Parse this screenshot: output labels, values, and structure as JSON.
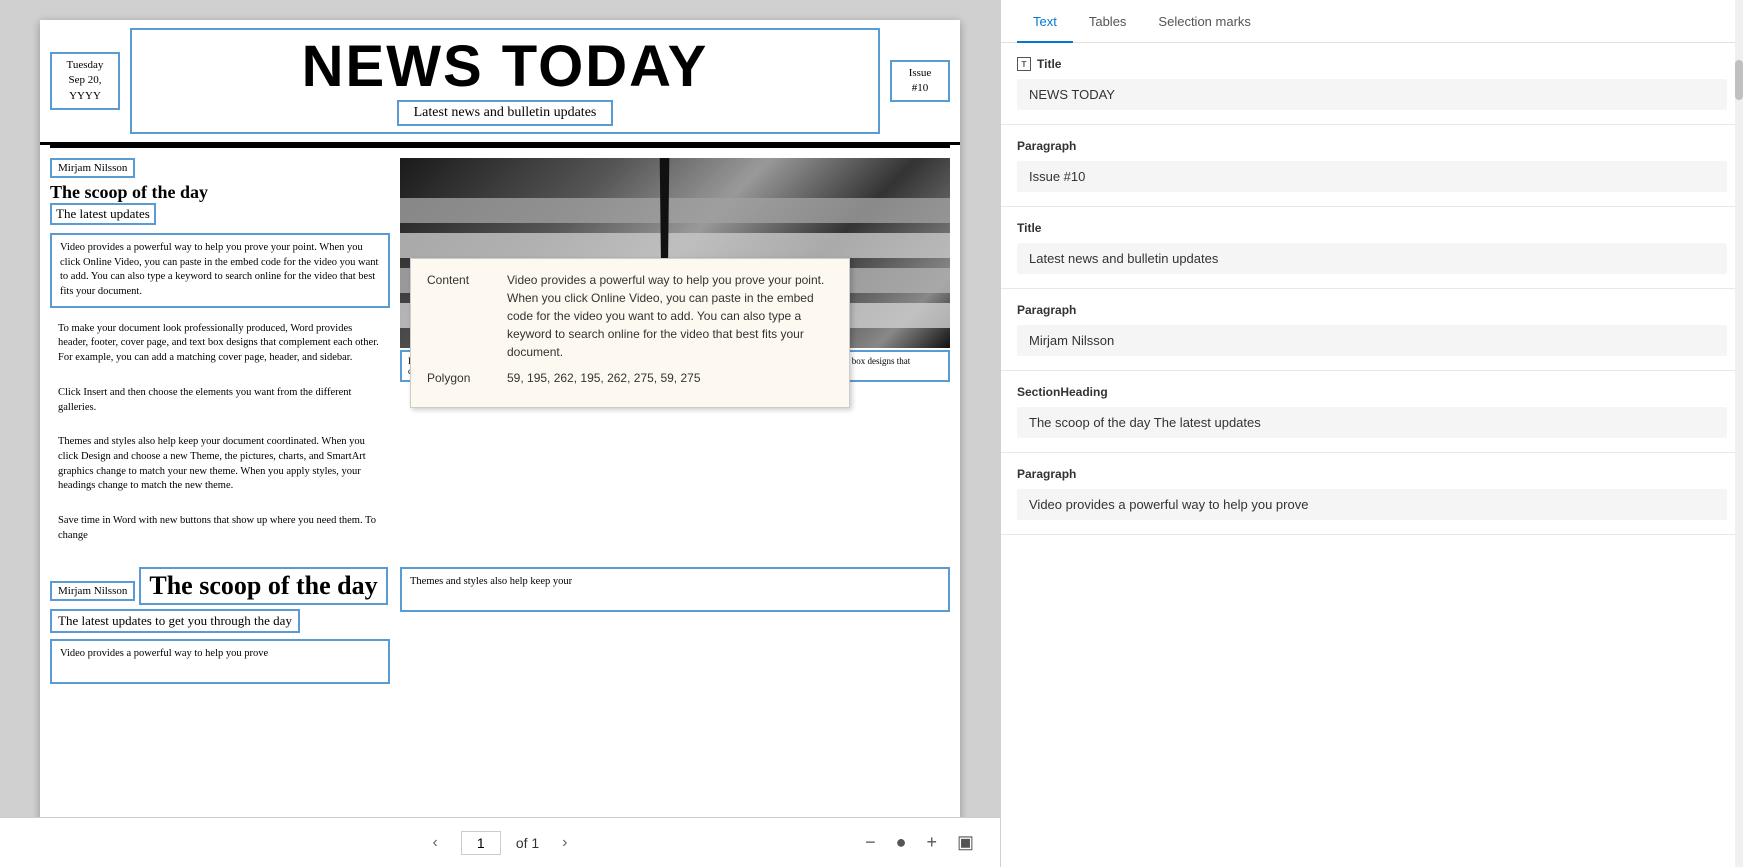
{
  "document": {
    "date": "Tuesday\nSep 20,\nYYYY",
    "title": "NEWS TODAY",
    "subtitle": "Latest news and bulletin updates",
    "issue": "Issue\n#10"
  },
  "left_column": {
    "author1": "Mirjam Nilsson",
    "heading1": "The scoop of the day",
    "subheading1": "The latest updates",
    "text1": "Video provides a powerful way to help you prove your point. When you click Online Video, you can paste in the embed code for the video you want to add. You can also type a keyword to search online for the video that best fits your document.",
    "text2": "To make your document look professionally produced, Word provides header, footer, cover page, and text box designs that complement each other. For example, you can add a matching cover page, header, and sidebar.",
    "text3": "Click Insert and then choose the elements you want from the different galleries.",
    "text4": "Themes and styles also help keep your document coordinated. When you click Design and choose a new Theme, the pictures, charts, and SmartArt graphics change to match your new theme. When you apply styles, your headings change to match the new theme.",
    "text5": "Save time in Word with new buttons that show up where you need them. To change"
  },
  "right_column": {
    "caption": "Picture Caption: To make your document look professionally produced, Word provides header, footer, cover page, and text box designs that complement each other.",
    "tooltip": {
      "content_label": "Content",
      "content_value": "Video provides a powerful way to help you prove your point. When you click Online Video, you can paste in the embed code for the video you want to add. You can also type a keyword to search online for the video that best fits your document.",
      "polygon_label": "Polygon",
      "polygon_value": "59, 195, 262, 195, 262, 275, 59, 275"
    }
  },
  "bottom_section": {
    "author2": "Mirjam Nilsson",
    "heading2": "The scoop of the day",
    "subheading2": "The latest updates to get you through the day",
    "text_partial": "Video provides a powerful way to help you prove",
    "themes_text": "Themes and styles also help keep your"
  },
  "pagination": {
    "current_page": "1",
    "of_label": "of 1",
    "page_label": "1"
  },
  "right_panel": {
    "tabs": [
      {
        "label": "Text",
        "active": true
      },
      {
        "label": "Tables",
        "active": false
      },
      {
        "label": "Selection marks",
        "active": false
      }
    ],
    "sections": [
      {
        "type": "Title",
        "value": "NEWS TODAY"
      },
      {
        "type": "Paragraph",
        "value": "Issue #10"
      },
      {
        "type": "Title",
        "value": "Latest news and bulletin updates"
      },
      {
        "type": "Paragraph",
        "value": "Mirjam Nilsson"
      },
      {
        "type": "SectionHeading",
        "value": "The scoop of the day The latest updates"
      },
      {
        "type": "Paragraph",
        "value": "Video provides a powerful way to help you prove"
      }
    ]
  }
}
